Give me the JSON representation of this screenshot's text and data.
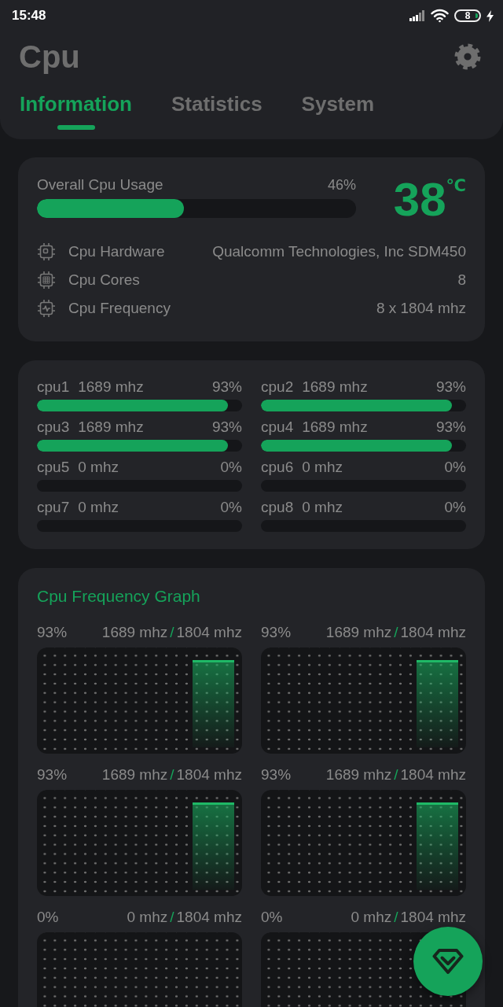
{
  "status_bar": {
    "time": "15:48",
    "battery": "8"
  },
  "app_bar": {
    "title": "Cpu"
  },
  "tabs": [
    {
      "label": "Information",
      "selected": true
    },
    {
      "label": "Statistics",
      "selected": false
    },
    {
      "label": "System",
      "selected": false
    }
  ],
  "overview": {
    "usage_label": "Overall Cpu Usage",
    "usage_percent": "46%",
    "level": 0.46,
    "temperature": "38",
    "temperature_unit": "℃",
    "details": [
      {
        "kind": "hardware",
        "label": "Cpu Hardware",
        "value": "Qualcomm Technologies, Inc SDM450"
      },
      {
        "kind": "cores",
        "label": "Cpu Cores",
        "value": "8"
      },
      {
        "kind": "frequency",
        "label": "Cpu Frequency",
        "value": "8 x 1804 mhz"
      }
    ]
  },
  "cores": [
    {
      "name": "cpu1",
      "frequency": "1689 mhz",
      "percent": "93%",
      "level": 0.93
    },
    {
      "name": "cpu2",
      "frequency": "1689 mhz",
      "percent": "93%",
      "level": 0.93
    },
    {
      "name": "cpu3",
      "frequency": "1689 mhz",
      "percent": "93%",
      "level": 0.93
    },
    {
      "name": "cpu4",
      "frequency": "1689 mhz",
      "percent": "93%",
      "level": 0.93
    },
    {
      "name": "cpu5",
      "frequency": "0 mhz",
      "percent": "0%",
      "level": 0
    },
    {
      "name": "cpu6",
      "frequency": "0 mhz",
      "percent": "0%",
      "level": 0
    },
    {
      "name": "cpu7",
      "frequency": "0 mhz",
      "percent": "0%",
      "level": 0
    },
    {
      "name": "cpu8",
      "frequency": "0 mhz",
      "percent": "0%",
      "level": 0
    }
  ],
  "frequency_graph": {
    "title": "Cpu Frequency Graph",
    "graphs": [
      {
        "percent": "93%",
        "current": "1689 mhz",
        "separator": "/",
        "max": "1804 mhz",
        "level": 0.93
      },
      {
        "percent": "93%",
        "current": "1689 mhz",
        "separator": "/",
        "max": "1804 mhz",
        "level": 0.93
      },
      {
        "percent": "93%",
        "current": "1689 mhz",
        "separator": "/",
        "max": "1804 mhz",
        "level": 0.93
      },
      {
        "percent": "93%",
        "current": "1689 mhz",
        "separator": "/",
        "max": "1804 mhz",
        "level": 0.93
      },
      {
        "percent": "0%",
        "current": "0 mhz",
        "separator": "/",
        "max": "1804 mhz",
        "level": 0
      },
      {
        "percent": "0%",
        "current": "0 mhz",
        "separator": "/",
        "max": "1804 mhz",
        "level": 0
      }
    ]
  }
}
